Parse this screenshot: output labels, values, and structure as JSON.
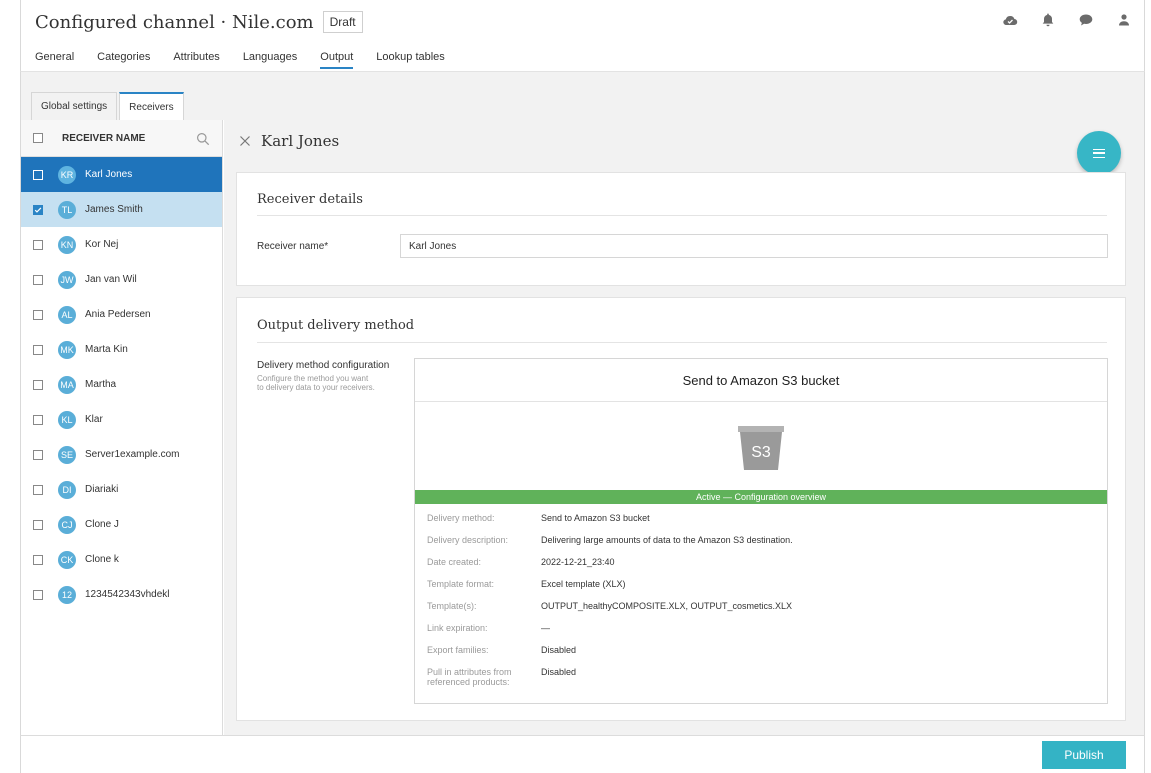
{
  "header": {
    "title": "Configured channel · Nile.com",
    "status_badge": "Draft",
    "icons": [
      "cloud-check-icon",
      "bell-icon",
      "chat-icon",
      "user-icon"
    ]
  },
  "nav_tabs": [
    "General",
    "Categories",
    "Attributes",
    "Languages",
    "Output",
    "Lookup tables"
  ],
  "active_nav_tab": "Output",
  "sub_tabs": [
    "Global settings",
    "Receivers"
  ],
  "active_sub_tab": "Receivers",
  "sidebar": {
    "column_header": "RECEIVER NAME",
    "items": [
      {
        "initials": "KR",
        "name": "Karl Jones",
        "state": "selected"
      },
      {
        "initials": "TL",
        "name": "James Smith",
        "state": "checked"
      },
      {
        "initials": "KN",
        "name": "Kor Nej",
        "state": ""
      },
      {
        "initials": "JW",
        "name": "Jan van Wil",
        "state": ""
      },
      {
        "initials": "AL",
        "name": "Ania Pedersen",
        "state": ""
      },
      {
        "initials": "MK",
        "name": "Marta Kin",
        "state": ""
      },
      {
        "initials": "MA",
        "name": "Martha",
        "state": ""
      },
      {
        "initials": "KL",
        "name": "Klar",
        "state": ""
      },
      {
        "initials": "SE",
        "name": "Server1example.com",
        "state": ""
      },
      {
        "initials": "DI",
        "name": "Diariaki",
        "state": ""
      },
      {
        "initials": "CJ",
        "name": "Clone J",
        "state": ""
      },
      {
        "initials": "CK",
        "name": "Clone k",
        "state": ""
      },
      {
        "initials": "12",
        "name": "1234542343vhdekl",
        "state": ""
      }
    ]
  },
  "main": {
    "title": "Karl Jones",
    "receiver_details": {
      "heading": "Receiver details",
      "field_label": "Receiver name*",
      "field_value": "Karl Jones"
    },
    "output_delivery": {
      "heading": "Output delivery method",
      "config_label": "Delivery method configuration",
      "config_help": "Configure the method you want to delivery data to your receivers.",
      "panel_title": "Send to Amazon S3 bucket",
      "bucket_label": "S3",
      "status": "Active — Configuration overview",
      "details": [
        {
          "key": "Delivery method:",
          "value": "Send to Amazon S3 bucket"
        },
        {
          "key": "Delivery description:",
          "value": "Delivering large amounts of data to the Amazon S3 destination."
        },
        {
          "key": "Date created:",
          "value": "2022-12-21_23:40"
        },
        {
          "key": "Template format:",
          "value": "Excel template (XLX)"
        },
        {
          "key": "Template(s):",
          "value": "OUTPUT_healthyCOMPOSITE.XLX, OUTPUT_cosmetics.XLX"
        },
        {
          "key": "Link expiration:",
          "value": "—"
        },
        {
          "key": "Export families:",
          "value": "Disabled"
        },
        {
          "key": "Pull in attributes from referenced products:",
          "value": "Disabled"
        }
      ]
    }
  },
  "footer": {
    "publish_label": "Publish"
  },
  "colors": {
    "accent": "#2a84c5",
    "selected_row": "#1f74bb",
    "checked_row": "#c5e0f1",
    "teal_button": "#34b3c5",
    "status_green": "#60b25a",
    "avatar": "#5aaed8"
  }
}
